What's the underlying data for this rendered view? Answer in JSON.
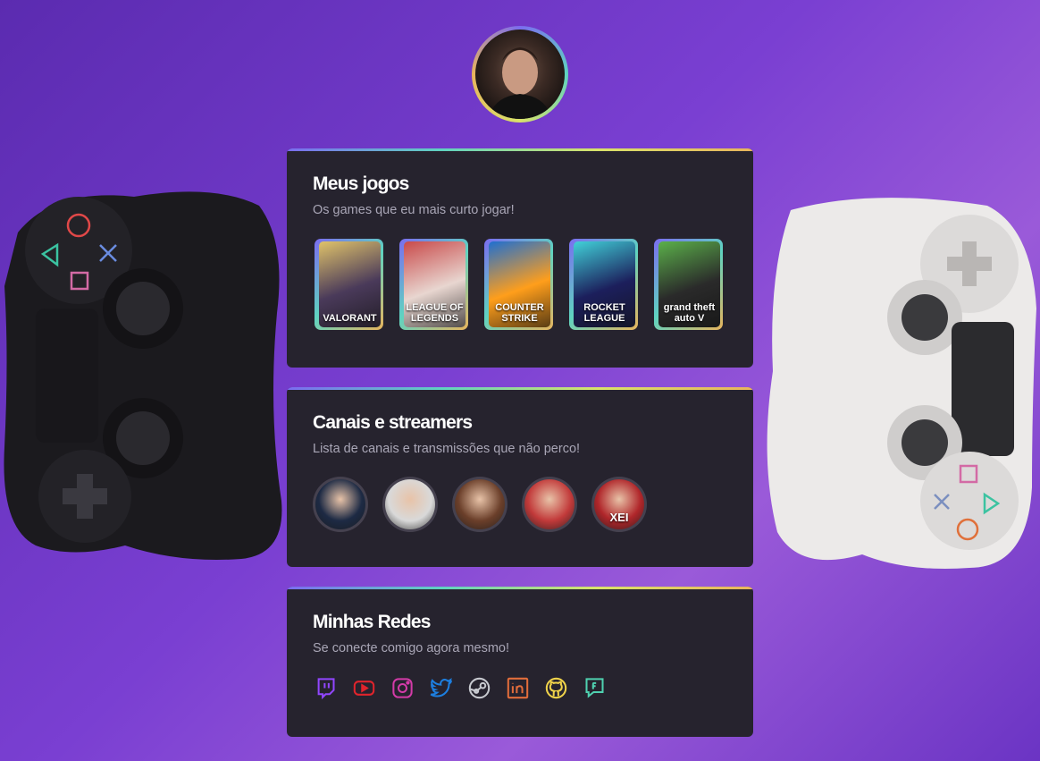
{
  "profile": {
    "avatar_alt": ""
  },
  "games_card": {
    "title": "Meus jogos",
    "subtitle": "Os games que eu mais curto jogar!",
    "games": [
      {
        "label": "VALORANT",
        "bg": "#4a3a5a",
        "accent": "#e0c36a"
      },
      {
        "label": "LEAGUE OF LEGENDS",
        "bg": "#e8d6d0",
        "accent": "#c94a4a"
      },
      {
        "label": "COUNTER STRIKE",
        "bg": "#ff9e1b",
        "accent": "#1f6fd1"
      },
      {
        "label": "ROCKET LEAGUE",
        "bg": "#1c1f5c",
        "accent": "#41d1d8"
      },
      {
        "label": "grand theft auto V",
        "bg": "#2a2a2a",
        "accent": "#5bb04a"
      }
    ]
  },
  "streamers_card": {
    "title": "Canais e streamers",
    "subtitle": "Lista de canais e transmissões que não perco!",
    "streamers": [
      {
        "name": "streamer-1",
        "bg": "#1d2a44"
      },
      {
        "name": "streamer-2",
        "bg": "#d9d9d9"
      },
      {
        "name": "streamer-3",
        "bg": "#6b3f2a"
      },
      {
        "name": "streamer-4",
        "bg": "#c23a3a"
      },
      {
        "name": "streamer-5",
        "bg": "#b0262a",
        "text": "XEI"
      }
    ]
  },
  "socials_card": {
    "title": "Minhas Redes",
    "subtitle": "Se conecte comigo agora mesmo!",
    "socials": [
      {
        "icon": "twitch-icon",
        "color": "#9146ff"
      },
      {
        "icon": "youtube-icon",
        "color": "#e0242c"
      },
      {
        "icon": "instagram-icon",
        "color": "#d43ba8"
      },
      {
        "icon": "twitter-icon",
        "color": "#1d7fe0"
      },
      {
        "icon": "steam-icon",
        "color": "#c7c9cf"
      },
      {
        "icon": "linkedin-icon",
        "color": "#e26d3b"
      },
      {
        "icon": "github-icon",
        "color": "#f0d34a"
      },
      {
        "icon": "forum-icon",
        "color": "#4fd1b0"
      }
    ]
  },
  "colors": {
    "card_bg": "#26232e",
    "title": "#ffffff",
    "subtitle": "#a9a6b6"
  }
}
